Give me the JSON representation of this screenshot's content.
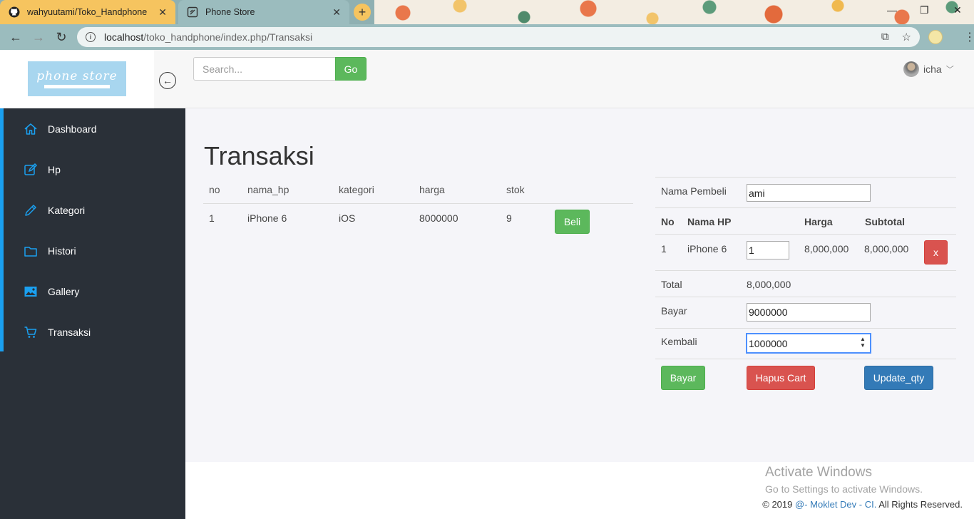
{
  "browser": {
    "tabs": [
      {
        "title": "wahyuutami/Toko_Handphone",
        "icon": "github-icon"
      },
      {
        "title": "Phone Store",
        "icon": "page-icon"
      }
    ],
    "new_tab": "+",
    "address": {
      "host": "localhost",
      "path": "/toko_handphone/index.php/Transaksi"
    }
  },
  "header": {
    "logo_text": "phone store",
    "search_placeholder": "Search...",
    "go_label": "Go",
    "user_name": "icha"
  },
  "sidebar": {
    "items": [
      {
        "label": "Dashboard",
        "icon": "home-icon"
      },
      {
        "label": "Hp",
        "icon": "edit-icon"
      },
      {
        "label": "Kategori",
        "icon": "pencil-icon"
      },
      {
        "label": "Histori",
        "icon": "folder-icon"
      },
      {
        "label": "Gallery",
        "icon": "image-icon"
      },
      {
        "label": "Transaksi",
        "icon": "cart-icon"
      }
    ]
  },
  "main": {
    "title": "Transaksi",
    "product_table": {
      "headers": [
        "no",
        "nama_hp",
        "kategori",
        "harga",
        "stok"
      ],
      "rows": [
        {
          "no": "1",
          "nama_hp": "iPhone 6",
          "kategori": "iOS",
          "harga": "8000000",
          "stok": "9",
          "action": "Beli"
        }
      ]
    },
    "cart": {
      "buyer_label": "Nama Pembeli",
      "buyer_value": "ami",
      "headers": {
        "no": "No",
        "nama": "Nama HP",
        "harga": "Harga",
        "subtotal": "Subtotal"
      },
      "items": [
        {
          "no": "1",
          "nama": "iPhone 6",
          "qty": "1",
          "harga": "8,000,000",
          "subtotal": "8,000,000",
          "remove": "x"
        }
      ],
      "total_label": "Total",
      "total_value": "8,000,000",
      "bayar_label": "Bayar",
      "bayar_value": "9000000",
      "kembali_label": "Kembali",
      "kembali_value": "1000000",
      "buttons": {
        "bayar": "Bayar",
        "hapus": "Hapus Cart",
        "update": "Update_qty"
      }
    }
  },
  "footer": {
    "activate_title": "Activate Windows",
    "activate_sub": "Go to Settings to activate Windows.",
    "copyright_prefix": "© 2019 ",
    "copyright_link": "@- Moklet Dev - CI.",
    "copyright_suffix": " All Rights Reserved."
  },
  "colors": {
    "sidebar_bg": "#2a3038",
    "sidebar_accent": "#1aa0f0",
    "success": "#5cb85c",
    "danger": "#d9534f",
    "primary": "#337ab7",
    "logo_bg": "#a8d6ef"
  }
}
